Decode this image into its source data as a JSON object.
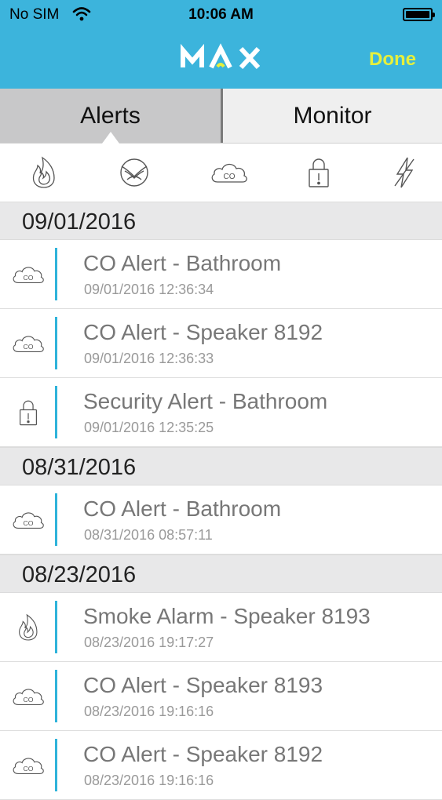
{
  "status_bar": {
    "carrier": "No SIM",
    "time": "10:06 AM"
  },
  "nav": {
    "logo_text": "MAX",
    "done_label": "Done"
  },
  "tabs": [
    {
      "label": "Alerts",
      "selected": true
    },
    {
      "label": "Monitor",
      "selected": false
    }
  ],
  "filters": [
    "smoke-icon",
    "flood-icon",
    "co-icon",
    "security-icon",
    "power-icon"
  ],
  "sections": [
    {
      "date": "09/01/2016",
      "items": [
        {
          "icon": "co-icon",
          "title": "CO Alert - Bathroom",
          "timestamp": "09/01/2016 12:36:34"
        },
        {
          "icon": "co-icon",
          "title": "CO Alert - Speaker 8192",
          "timestamp": "09/01/2016 12:36:33"
        },
        {
          "icon": "security-icon",
          "title": "Security Alert - Bathroom",
          "timestamp": "09/01/2016 12:35:25"
        }
      ]
    },
    {
      "date": "08/31/2016",
      "items": [
        {
          "icon": "co-icon",
          "title": "CO Alert - Bathroom",
          "timestamp": "08/31/2016 08:57:11"
        }
      ]
    },
    {
      "date": "08/23/2016",
      "items": [
        {
          "icon": "smoke-icon",
          "title": "Smoke Alarm - Speaker 8193",
          "timestamp": "08/23/2016 19:17:27"
        },
        {
          "icon": "co-icon",
          "title": "CO Alert - Speaker 8193",
          "timestamp": "08/23/2016 19:16:16"
        },
        {
          "icon": "co-icon",
          "title": "CO Alert - Speaker 8192",
          "timestamp": "08/23/2016 19:16:16"
        }
      ]
    }
  ],
  "colors": {
    "header": "#3cb4dc",
    "done": "#e6f03c",
    "accent_bar": "#2eb3da"
  }
}
